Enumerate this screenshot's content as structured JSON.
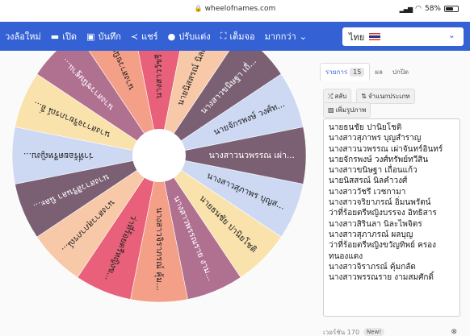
{
  "browser": {
    "url": "wheelofnames.com",
    "battery": "58%"
  },
  "toolbar": {
    "items": [
      {
        "label": "วงล้อใหม่",
        "icon": "refresh-icon"
      },
      {
        "label": "เปิด",
        "icon": "folder-icon"
      },
      {
        "label": "บันทึก",
        "icon": "save-icon"
      },
      {
        "label": "แชร์",
        "icon": "share-icon"
      },
      {
        "label": "ปรับแต่ง",
        "icon": "palette-icon"
      },
      {
        "label": "เต็มจอ",
        "icon": "fullscreen-icon"
      },
      {
        "label": "มากกว่า",
        "icon": "chevron-down-icon"
      }
    ],
    "language": "ไทย"
  },
  "panel": {
    "tabs": [
      {
        "label": "รายการ",
        "count": "15"
      },
      {
        "label": "ผล"
      },
      {
        "label": "ปกปิด"
      }
    ],
    "buttons": {
      "shuffle": "สลับ",
      "sort": "จำแนกประเภท",
      "add_image": "เพิ่มรูปภาพ"
    },
    "entries": [
      "นายธนชัย ปานิยโชติ",
      "นางสาวสุภาพร บุญสำราญ",
      "นางสาวนวพรรณ เผ่าจันทร์อินทร์",
      "นายจักรพงษ์ วงศ์ทรัพย์ทวีสิน",
      "นางสาวขนิษฐา เถื่อนแก้ว",
      "นายนิสสรณ์ นิลคำวงศ์",
      "นางสาววัชรี เวชกามา",
      "นางสาวจริยาภรณ์ อิ่มนพรัตน์",
      "ว่าที่ร้อยตรีหญิงบรรจง อิทธิสาร",
      "นางสาวสิรินลา นิละไพจิตร",
      "นางสาวสุภาภรณ์ ผลบุญ",
      "ว่าที่ร้อยตรีหญิงขวัญทิพย์ ครอง",
      "ทนองแดง",
      "นางสาวจิราภรณ์ คุ้มกลัด",
      "นางสาวพรรณราย งามสมศักดิ์"
    ],
    "footer": {
      "version": "เวอร์ชัน 170",
      "new_badge": "New!"
    }
  },
  "wheel": {
    "labels": [
      "นางสาวนวพรรณ เผ่า...",
      "นางสาวสุภาพร บุญส...",
      "นายธนชัย ปานิยโชติ",
      "นางสาวพรรณราย งาม...",
      "นางสาวจิราภรณ์ คุ้ม...",
      "ว่าที่ร้อยตรีหญิงข...",
      "นางสาวสุภาภรณ์...",
      "นางสาวสิรินลา นิละ...",
      "ว่าที่ร้อยตรีหญิงบ...",
      "นางสาวจริยาภรณ์ อิ่...",
      "นางสาวชนิษฐาแ...",
      "นางสาวขนิษฐา...",
      "นางสาววัชรี เวชกา...",
      "นายนิสสรณ์ นิลคำว...",
      "นางสาวขนิษฐา เถื่...",
      "นายจักรพงษ์ วงศ์ท..."
    ],
    "colors": [
      "#7a6072",
      "#cdd8f3",
      "#fae2ad",
      "#b07090",
      "#f4a088",
      "#e8607a",
      "#f7c9a9"
    ]
  }
}
